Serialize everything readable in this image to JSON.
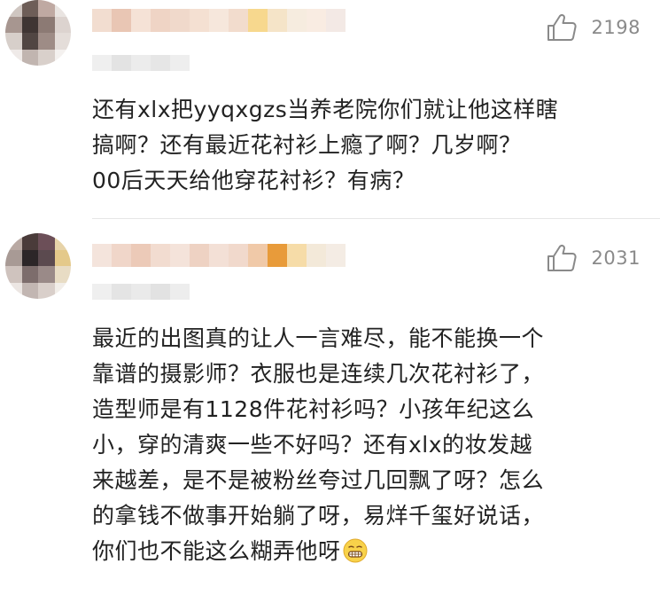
{
  "comments": [
    {
      "like_count": "2198",
      "text": "还有xlx把yyqxgzs当养老院你们就让他这样瞎\n搞啊？还有最近花衬衫上瘾了啊？几岁啊？\n00后天天给他穿花衬衫？有病？",
      "avatar_colors": [
        "#cfc6c1",
        "#6e5e58",
        "#bfa9a2",
        "#e9e4e1",
        "#a79690",
        "#3f3533",
        "#8c7a74",
        "#dcd3cf",
        "#d7cfca",
        "#514643",
        "#9e8c86",
        "#e4ddd9",
        "#efeae8",
        "#c1b5b0",
        "#d9d0cb",
        "#f4f1ef"
      ],
      "name_mosaic_colors": [
        "#f2ddd0",
        "#e9c6b4",
        "#f5e2d6",
        "#efd4c5",
        "#f0d9cb",
        "#f4e0d2",
        "#f6e7dc",
        "#f2dccd",
        "#f7d88e",
        "#f5e4c8",
        "#f6ecdf",
        "#f9ece2",
        "#f3e9e5"
      ],
      "meta_mosaic_colors": [
        "#efefef",
        "#e3e3e3",
        "#ececec",
        "#e6e6e6",
        "#eeeeee"
      ]
    },
    {
      "like_count": "2031",
      "text": "最近的出图真的让人一言难尽，能不能换一个\n靠谱的摄影师？衣服也是连续几次花衬衫了，\n造型师是有1128件花衬衫吗？小孩年纪这么\n小，穿的清爽一些不好吗？还有xlx的妆发越\n来越差，是不是被粉丝夸过几回飘了呀？怎么\n的拿钱不做事开始躺了呀，易烊千玺好说话，\n你们也不能这么糊弄他呀",
      "avatar_colors": [
        "#b9a9a3",
        "#4a3b3a",
        "#6c4f58",
        "#e7d3a8",
        "#a89a95",
        "#2c2628",
        "#5b4a4f",
        "#e4c98a",
        "#cfc3be",
        "#7d6d6c",
        "#9a8a88",
        "#e8dcc4",
        "#ece6e3",
        "#c2b6b2",
        "#d9cfca",
        "#f2eee9"
      ],
      "name_mosaic_colors": [
        "#f4e4dc",
        "#f0d6c9",
        "#eccab8",
        "#f2dcd0",
        "#f4e3da",
        "#eed2c3",
        "#f3e0d6",
        "#f1d9cc",
        "#f0c9a8",
        "#e89b3a",
        "#f6dca8",
        "#f3e9d9",
        "#f4ece4"
      ],
      "meta_mosaic_colors": [
        "#efefef",
        "#e4e4e4",
        "#eaeaea",
        "#e2e2e2",
        "#ededed"
      ],
      "emoji": "grimacing-face"
    }
  ],
  "colors": {
    "text": "#222222",
    "like": "#8a8a8a",
    "divider": "#e6e6e6"
  }
}
